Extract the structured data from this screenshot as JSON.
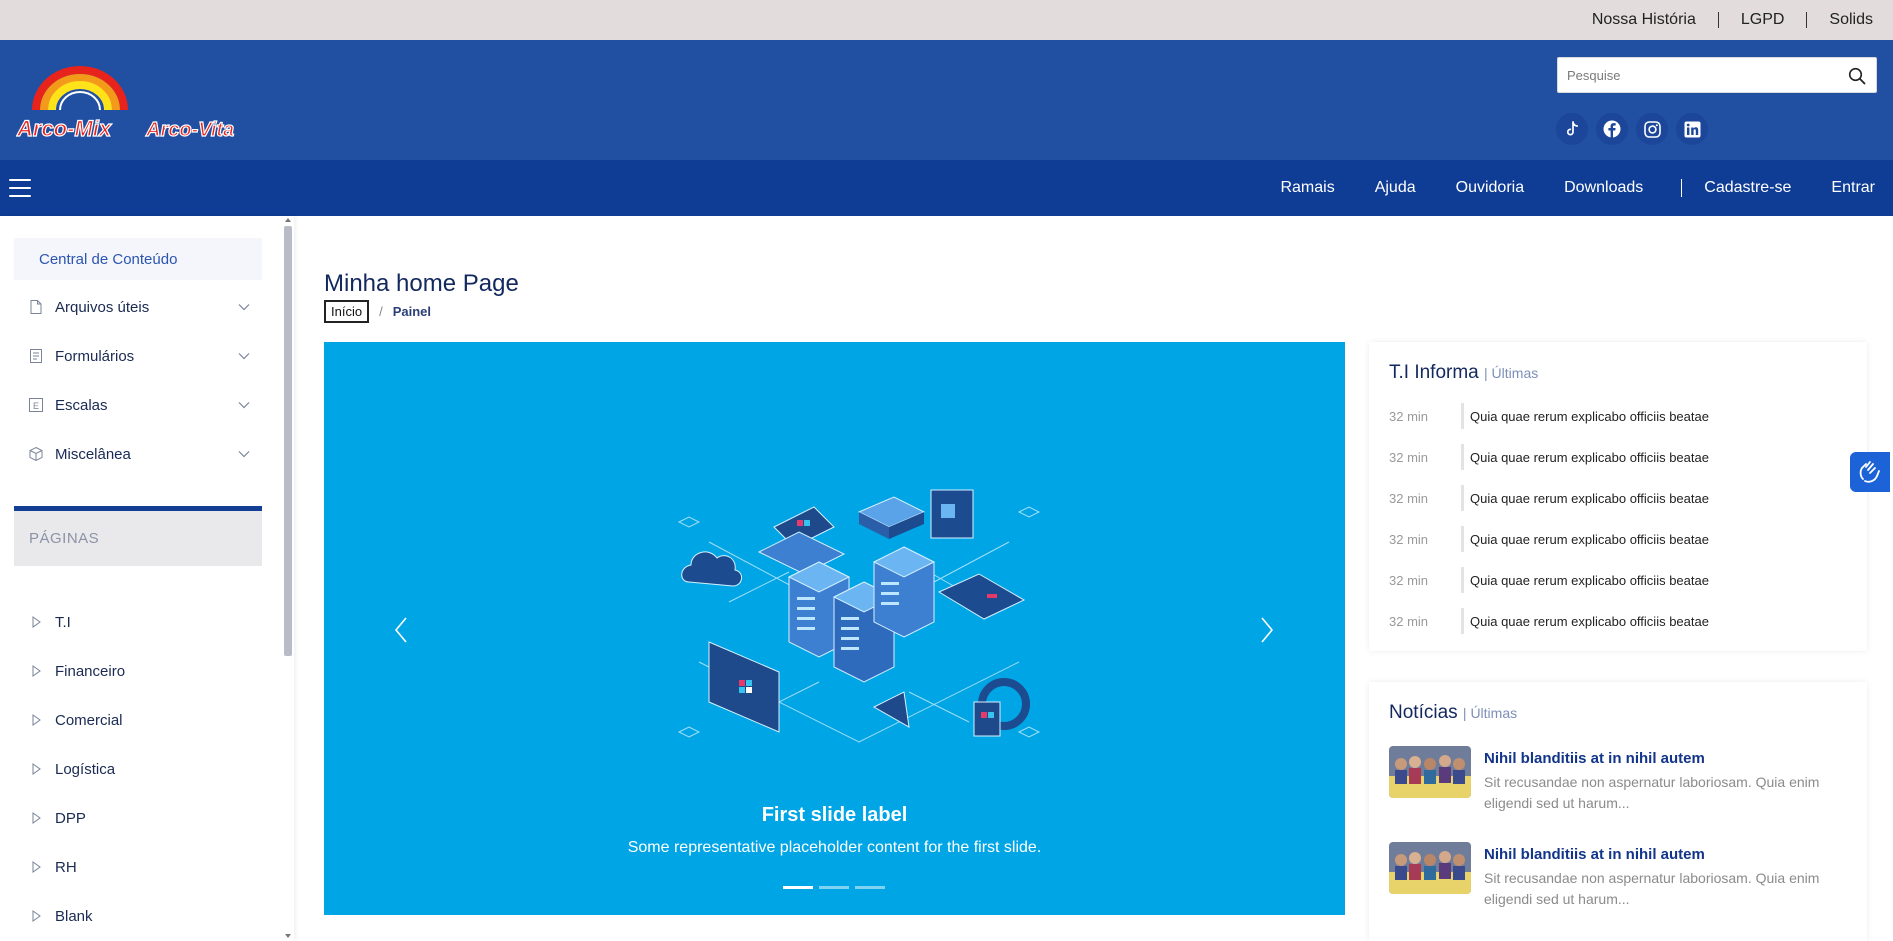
{
  "topbar": {
    "links": [
      "Nossa História",
      "LGPD",
      "Solids"
    ]
  },
  "header": {
    "logo_left": "Arco-Mix",
    "logo_right": "Arco-Vita",
    "search_placeholder": "Pesquise",
    "socials": [
      "tiktok-icon",
      "facebook-icon",
      "instagram-icon",
      "linkedin-icon"
    ]
  },
  "nav": {
    "links": [
      "Ramais",
      "Ajuda",
      "Ouvidoria",
      "Downloads"
    ],
    "auth": [
      "Cadastre-se",
      "Entrar"
    ]
  },
  "sidebar": {
    "central": "Central de Conteúdo",
    "items": [
      {
        "label": "Arquivos úteis",
        "icon": "file-icon"
      },
      {
        "label": "Formulários",
        "icon": "form-icon"
      },
      {
        "label": "Escalas",
        "icon": "scale-icon"
      },
      {
        "label": "Miscelânea",
        "icon": "box-icon"
      }
    ],
    "pages_heading": "PÁGINAS",
    "pages": [
      "T.I",
      "Financeiro",
      "Comercial",
      "Logística",
      "DPP",
      "RH",
      "Blank"
    ]
  },
  "main": {
    "title": "Minha home Page",
    "breadcrumb": {
      "home": "Início",
      "current": "Painel"
    },
    "carousel": {
      "title": "First slide label",
      "caption": "Some representative placeholder content for the first slide.",
      "slides": 3,
      "active": 0
    }
  },
  "ti_panel": {
    "title": "T.I Informa",
    "subtitle": "| Últimas",
    "rows": [
      {
        "time": "32 min",
        "text": "Quia quae rerum explicabo officiis beatae"
      },
      {
        "time": "32 min",
        "text": "Quia quae rerum explicabo officiis beatae"
      },
      {
        "time": "32 min",
        "text": "Quia quae rerum explicabo officiis beatae"
      },
      {
        "time": "32 min",
        "text": "Quia quae rerum explicabo officiis beatae"
      },
      {
        "time": "32 min",
        "text": "Quia quae rerum explicabo officiis beatae"
      },
      {
        "time": "32 min",
        "text": "Quia quae rerum explicabo officiis beatae"
      }
    ]
  },
  "news_panel": {
    "title": "Notícias",
    "subtitle": "| Últimas",
    "items": [
      {
        "title": "Nihil blanditiis at in nihil autem",
        "text": "Sit recusandae non aspernatur laboriosam. Quia enim eligendi sed ut harum..."
      },
      {
        "title": "Nihil blanditiis at in nihil autem",
        "text": "Sit recusandae non aspernatur laboriosam. Quia enim eligendi sed ut harum..."
      }
    ]
  },
  "colors": {
    "header": "#2150a2",
    "navbar": "#0f3c94",
    "topbar": "#e2dcdc",
    "carousel": "#00a5e6",
    "accent": "#12348a"
  }
}
